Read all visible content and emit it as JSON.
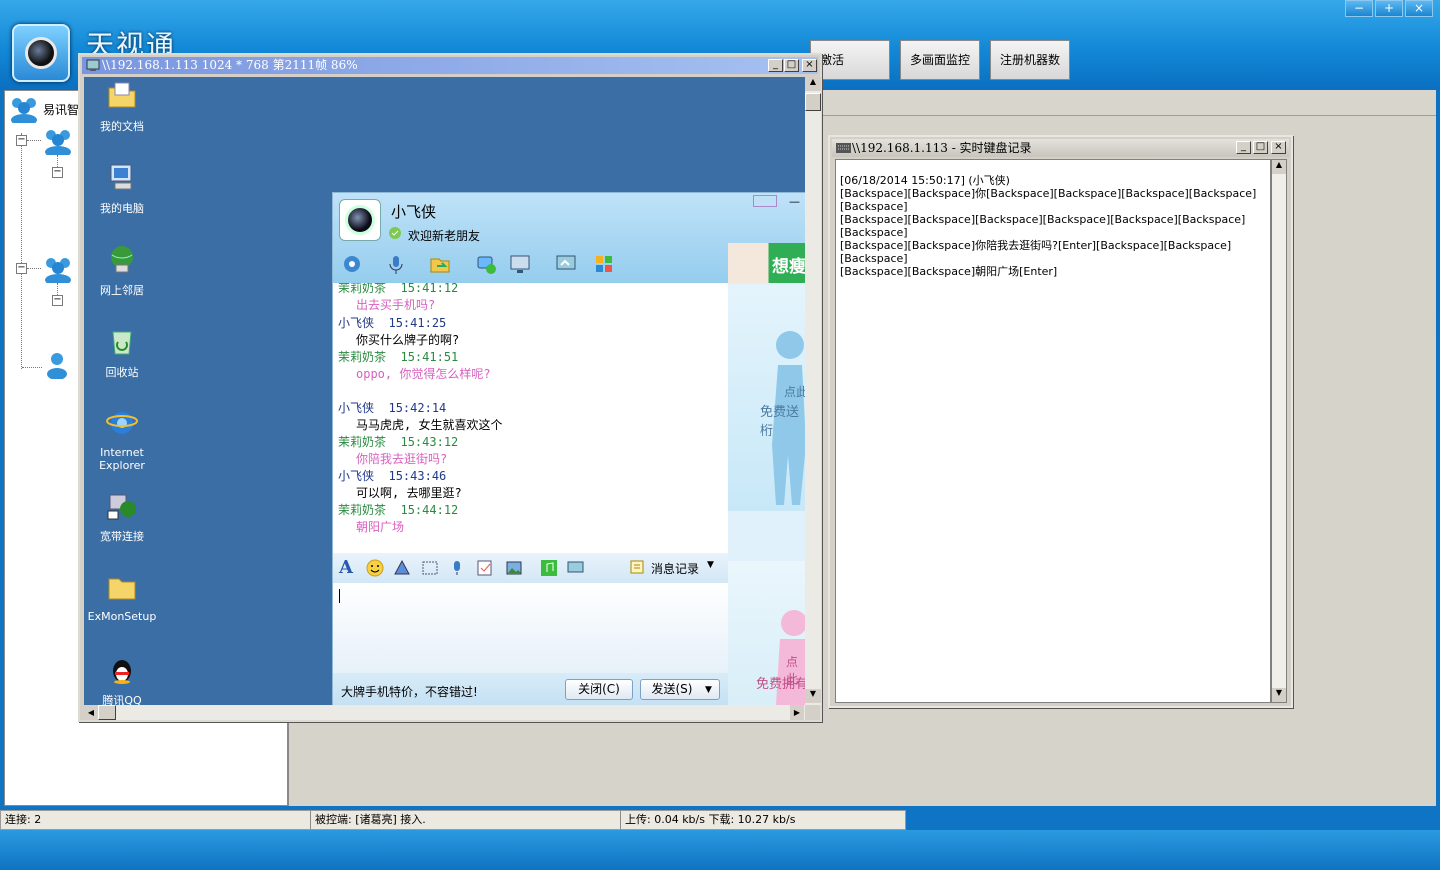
{
  "app": {
    "title": "天视通",
    "window_buttons": [
      "−",
      "+",
      "×"
    ]
  },
  "top_buttons": [
    "激活",
    "多画面监控",
    "注册机器数"
  ],
  "tree": {
    "root_label": "易讯智"
  },
  "status_bar": {
    "connections": "连接: 2",
    "controlled": "被控端: [诸葛亮] 接入.",
    "traffic": "上传: 0.04 kb/s 下载: 10.27 kb/s"
  },
  "remote_window": {
    "title": "\\\\192.168.1.113 1024 * 768 第2111帧 86%",
    "desktop_icons": [
      {
        "label": "我的文档",
        "icon": "folder-docs-icon"
      },
      {
        "label": "我的电脑",
        "icon": "computer-icon"
      },
      {
        "label": "网上邻居",
        "icon": "network-icon"
      },
      {
        "label": "回收站",
        "icon": "recycle-bin-icon"
      },
      {
        "label": "Internet Explorer",
        "icon": "internet-explorer-icon"
      },
      {
        "label": "宽带连接",
        "icon": "broadband-icon"
      },
      {
        "label": "ExMonSetup",
        "icon": "folder-icon"
      },
      {
        "label": "腾讯QQ",
        "icon": "qq-penguin-icon"
      }
    ]
  },
  "qq_chat": {
    "contact_name": "小飞侠",
    "signature": "欢迎新老朋友",
    "ad_banner": "想瘦",
    "ad_text_1a": "点此",
    "ad_text_1b": "免费送桁",
    "ad_text_2a": "点此",
    "ad_text_2b": "免费拥有",
    "messages": [
      {
        "sender": "茉莉奶茶",
        "time": "15:41:12",
        "text": "出去买手机吗?",
        "side": "her"
      },
      {
        "sender": "小飞侠",
        "time": "15:41:25",
        "text": "你买什么牌子的啊?",
        "side": "me"
      },
      {
        "sender": "茉莉奶茶",
        "time": "15:41:51",
        "text": "oppo, 你觉得怎么样呢?",
        "side": "her"
      },
      {
        "sender": "小飞侠",
        "time": "15:42:14",
        "text": "马马虎虎, 女生就喜欢这个",
        "side": "me"
      },
      {
        "sender": "茉莉奶茶",
        "time": "15:43:12",
        "text": "你陪我去逛街吗?",
        "side": "her"
      },
      {
        "sender": "小飞侠",
        "time": "15:43:46",
        "text": "可以啊, 去哪里逛?",
        "side": "me"
      },
      {
        "sender": "茉莉奶茶",
        "time": "15:44:12",
        "text": "朝阳广场",
        "side": "her"
      }
    ],
    "history_label": "消息记录",
    "promo_text": "大牌手机特价，不容错过!",
    "close_button": "关闭(C)",
    "send_button": "发送(S)"
  },
  "keylog_window": {
    "title": "\\\\192.168.1.113 - 实时键盘记录",
    "lines": [
      "[06/18/2014 15:50:17] (小飞侠)",
      " [Backspace][Backspace]你[Backspace][Backspace][Backspace][Backspace][Backspace]",
      "[Backspace][Backspace][Backspace][Backspace][Backspace][Backspace][Backspace]",
      "[Backspace][Backspace]你陪我去逛街吗?[Enter][Backspace][Backspace][Backspace]",
      "[Backspace][Backspace]朝阳广场[Enter]"
    ]
  },
  "colors": {
    "her_name": "#2a8a40",
    "her_text": "#d860c0",
    "me_name": "#203a8a",
    "me_text": "#000000",
    "titlebar_blue": "#1288d6"
  }
}
